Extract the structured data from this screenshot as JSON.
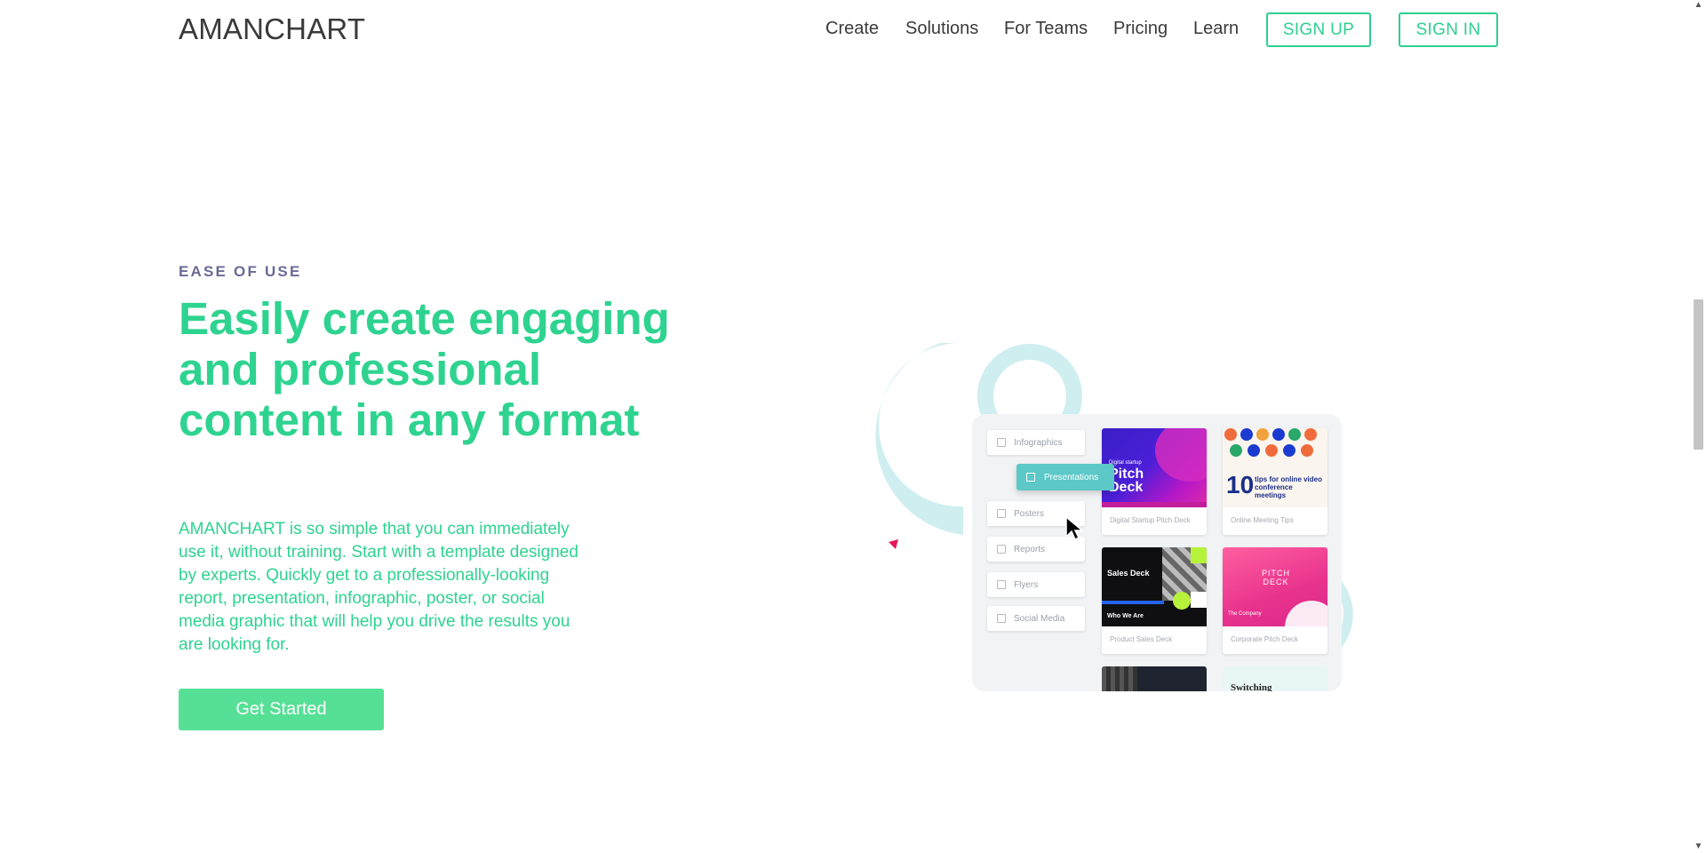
{
  "header": {
    "logo": "AMANCHART",
    "nav": [
      "Create",
      "Solutions",
      "For Teams",
      "Pricing",
      "Learn"
    ],
    "signup_label": "SIGN UP",
    "signin_label": "SIGN IN"
  },
  "hero": {
    "eyebrow": "EASE OF USE",
    "headline": "Easily create engaging and professional content in any format",
    "description": "AMANCHART is so simple that you can immediately use it, without training. Start with a template designed by experts. Quickly get to a professionally-looking report, presentation, infographic, poster, or social media graphic that will help you drive the results you are looking for.",
    "cta_label": "Get Started"
  },
  "illustration": {
    "menu": [
      "Infographics",
      "Presentations",
      "Posters",
      "Reports",
      "Flyers",
      "Social Media"
    ],
    "active_menu": "Presentations",
    "cards": [
      {
        "caption": "Digital Startup Pitch Deck",
        "title": "Pitch Deck",
        "kicker": "Digital startup"
      },
      {
        "caption": "Online Meeting Tips",
        "number": "10",
        "title": "tips for online video conference meetings"
      },
      {
        "caption": "Product Sales Deck",
        "title": "Sales Deck",
        "subtitle": "Who We Are"
      },
      {
        "caption": "Corporate Pitch Deck",
        "title": "PITCH DECK",
        "subtitle": "The Company"
      }
    ],
    "partial_card_title": "Switching"
  },
  "colors": {
    "accent": "#2ed38f",
    "button": "#55e096",
    "eyebrow": "#6a6a96",
    "teal_light": "#cfeef0",
    "teal_active": "#5cc8c8"
  }
}
